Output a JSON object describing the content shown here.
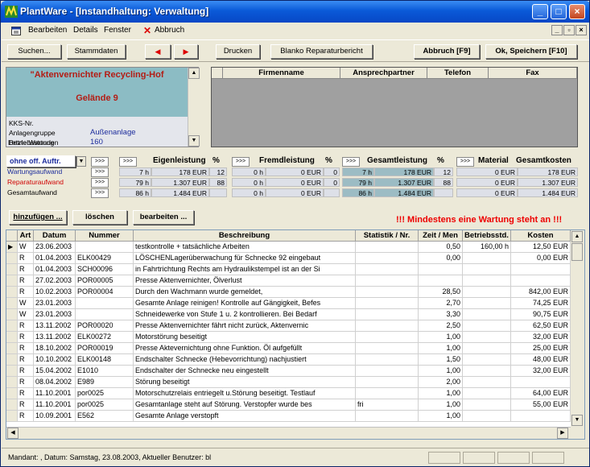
{
  "window": {
    "title": "PlantWare - [Instandhaltung: Verwaltung]"
  },
  "menu": {
    "items": [
      "Bearbeiten",
      "Details",
      "Fenster"
    ],
    "abbruch": "Abbruch",
    "mdi": [
      "_",
      "▫",
      "×"
    ]
  },
  "toolbar": {
    "suchen": "Suchen...",
    "stammdaten": "Stammdaten",
    "prev": "◀",
    "next": "▶",
    "drucken": "Drucken",
    "blanko": "Blanko Reparaturbericht",
    "abbruch": "Abbruch [F9]",
    "ok": "Ok, Speichern [F10]"
  },
  "info": {
    "name": "\"Aktenvernichter Recycling-Hof",
    "site": "Gelände 9",
    "rows": [
      {
        "label": "KKS-Nr.",
        "value": ""
      },
      {
        "label": "Anlagengruppe",
        "value": "Außenanlage"
      },
      {
        "label": "Betriebsstunden",
        "value": "160"
      },
      {
        "label": "Letzte Wartung",
        "value": ""
      }
    ]
  },
  "contacts": {
    "headers": [
      "Firmenname",
      "Ansprechpartner",
      "Telefon",
      "Fax"
    ]
  },
  "summary": {
    "filter": "ohne off. Auftr.",
    "more": ">>>",
    "headers": {
      "eigen": "Eigenleistung",
      "fremd": "Fremdleistung",
      "gesamt": "Gesamtleistung",
      "material": "Material",
      "kosten": "Gesamtkosten",
      "pct": "%"
    },
    "rows": [
      {
        "label": "Wartungsaufwand",
        "color": "#1c2c9c",
        "eh": "7 h",
        "ee": "178 EUR",
        "ep": "12",
        "fh": "0 h",
        "fe": "0 EUR",
        "fp": "0",
        "gh": "7 h",
        "ge": "178 EUR",
        "gp": "12",
        "me": "0 EUR",
        "ke": "178 EUR"
      },
      {
        "label": "Reparaturaufwand",
        "color": "#d00000",
        "eh": "79 h",
        "ee": "1.307 EUR",
        "ep": "88",
        "fh": "0 h",
        "fe": "0 EUR",
        "fp": "0",
        "gh": "79 h",
        "ge": "1.307 EUR",
        "gp": "88",
        "me": "0 EUR",
        "ke": "1.307 EUR"
      },
      {
        "label": "Gesamtaufwand",
        "color": "#000000",
        "eh": "86 h",
        "ee": "1.484 EUR",
        "ep": "",
        "fh": "0 h",
        "fe": "0 EUR",
        "fp": "",
        "gh": "86 h",
        "ge": "1.484 EUR",
        "gp": "",
        "me": "0 EUR",
        "ke": "1.484 EUR"
      }
    ]
  },
  "actions": {
    "add": "hinzufügen ...",
    "delete": "löschen",
    "edit": "bearbeiten ..."
  },
  "warning": "!!! Mindestens eine Wartung steht an !!!",
  "grid": {
    "headers": [
      "Art",
      "Datum",
      "Nummer",
      "Beschreibung",
      "Statistik / Nr.",
      "Zeit / Men",
      "Betriebsstd.",
      "Kosten"
    ],
    "rows": [
      [
        "W",
        "23.06.2003",
        "",
        "testkontrolle + tatsächliche Arbeiten",
        "",
        "0,50",
        "160,00 h",
        "12,50 EUR"
      ],
      [
        "R",
        "01.04.2003",
        "ELK00429",
        " LÖSCHENLagerüberwachung für Schnecke 92 eingebaut",
        "",
        "0,00",
        "",
        "0,00 EUR"
      ],
      [
        "R",
        "01.04.2003",
        "SCH00096",
        "in Fahrtrichtung Rechts am Hydraulikstempel ist an der Si",
        "",
        "",
        "",
        ""
      ],
      [
        "R",
        "27.02.2003",
        "POR00005",
        "Presse Aktenvernichter, Ölverlust",
        "",
        "",
        "",
        ""
      ],
      [
        "R",
        "10.02.2003",
        "POR00004",
        "Durch den Wachmann wurde gemeldet,",
        "",
        "28,50",
        "",
        "842,00 EUR"
      ],
      [
        "W",
        "23.01.2003",
        "",
        "Gesamte Anlage reinigen! Kontrolle auf Gängigkeit, Befes",
        "",
        "2,70",
        "",
        "74,25 EUR"
      ],
      [
        "W",
        "23.01.2003",
        "",
        "Schneidewerke von Stufe 1 u. 2 kontrollieren. Bei Bedarf",
        "",
        "3,30",
        "",
        "90,75 EUR"
      ],
      [
        "R",
        "13.11.2002",
        "POR00020",
        "Presse Aktenvernichter fährt nicht zurück, Aktenvernic",
        "",
        "2,50",
        "",
        "62,50 EUR"
      ],
      [
        "R",
        "13.11.2002",
        "ELK00272",
        "Motorstörung beseitigt",
        "",
        "1,00",
        "",
        "32,00 EUR"
      ],
      [
        "R",
        "18.10.2002",
        "POR00019",
        "Presse Aktevernichtung ohne Funktion. Öl aufgefüllt",
        "",
        "1,00",
        "",
        "25,00 EUR"
      ],
      [
        "R",
        "10.10.2002",
        "ELK00148",
        "Endschalter Schnecke (Hebevorrichtung) nachjustiert",
        "",
        "1,50",
        "",
        "48,00 EUR"
      ],
      [
        "R",
        "15.04.2002",
        "E1010",
        "Endschalter der Schnecke neu eingestellt",
        "",
        "1,00",
        "",
        "32,00 EUR"
      ],
      [
        "R",
        "08.04.2002",
        "E989",
        "Störung beseitigt",
        "",
        "2,00",
        "",
        ""
      ],
      [
        "R",
        "11.10.2001",
        "por0025",
        "Motorschutzrelais entriegelt u.Störung beseitigt. Testlauf",
        "",
        "1,00",
        "",
        "64,00 EUR"
      ],
      [
        "R",
        "11.10.2001",
        "por0025",
        "Gesamtanlage steht auf Störung. Verstopfer  wurde bes",
        "fri",
        "1,00",
        "",
        "55,00 EUR"
      ],
      [
        "R",
        "10.09.2001",
        "E562",
        "Gesamte Anlage verstopft",
        "",
        "1,00",
        "",
        ""
      ]
    ]
  },
  "status": "Mandant: , Datum: Samstag, 23.08.2003, Aktueller Benutzer: bl"
}
